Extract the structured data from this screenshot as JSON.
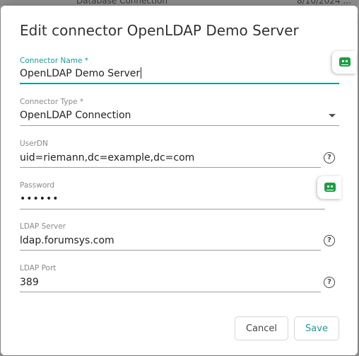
{
  "background": {
    "left_text": "Database Connection",
    "right_text": "8/10/2024 ..."
  },
  "dialog": {
    "title": "Edit connector OpenLDAP Demo Server",
    "fields": [
      {
        "label": "Connector Name *",
        "value": "OpenLDAP Demo Server",
        "focused": true
      },
      {
        "label": "Connector Type *",
        "value": "OpenLDAP Connection",
        "type": "select"
      },
      {
        "label": "UserDN",
        "value": "uid=riemann,dc=example,dc=com",
        "help_icon": "help-circle-icon"
      },
      {
        "label": "Password",
        "value": "••••••",
        "type": "password"
      },
      {
        "label": "LDAP Server",
        "value": "ldap.forumsys.com",
        "help_icon": "help-circle-icon"
      },
      {
        "label": "LDAP Port",
        "value": "389",
        "help_icon": "help-circle-icon"
      }
    ],
    "buttons": {
      "cancel": "Cancel",
      "save": "Save"
    }
  },
  "help_glyph": "?",
  "colors": {
    "accent": "#1a9b94",
    "password_manager": "#1f9d44",
    "backdrop": "#9a9a9a"
  },
  "icons": {
    "password_manager": "password-manager-icon",
    "dropdown": "dropdown-arrow-icon"
  }
}
